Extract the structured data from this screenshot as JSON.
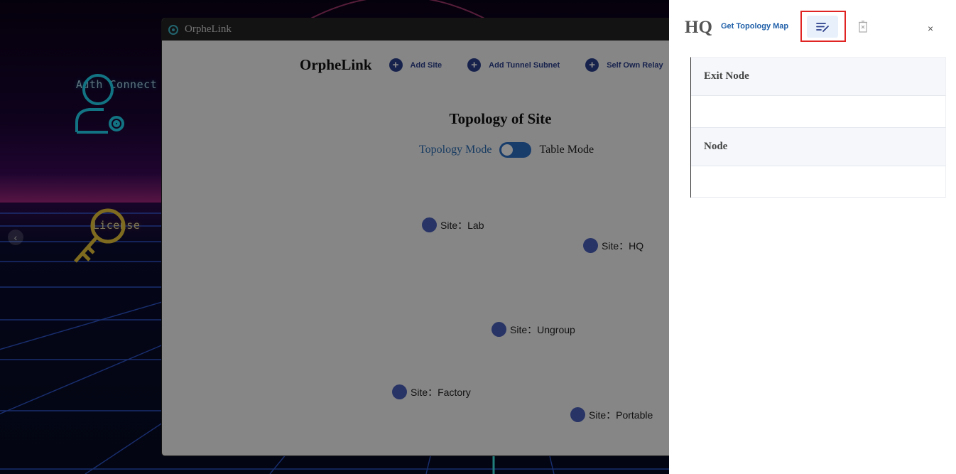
{
  "desktop": {
    "icons": [
      {
        "label": "Auth Connect",
        "icon": "user-gear-icon"
      },
      {
        "label": "License",
        "icon": "key-icon"
      }
    ],
    "carousel_prev": "‹"
  },
  "window": {
    "title": "OrpheLink",
    "toolbar": {
      "brand": "OrpheLink",
      "buttons": [
        "Add Site",
        "Add Tunnel Subnet",
        "Self Own Relay"
      ]
    },
    "topology_title": "Topology of Site",
    "modes": {
      "topology": "Topology Mode",
      "table": "Table Mode",
      "active": "Topology Mode"
    },
    "sites": [
      "Site：Lab",
      "Site：HQ",
      "Site：Ungroup",
      "Site：Factory",
      "Site：Portable"
    ]
  },
  "drawer": {
    "title": "HQ",
    "get_topology_link": "Get Topology Map",
    "close_label": "×",
    "table": [
      {
        "header": "Exit Node",
        "value": ""
      },
      {
        "header": "Node",
        "value": ""
      }
    ]
  },
  "colors": {
    "accent": "#2b3f8a",
    "node": "#4a60b8",
    "link": "#1f5fa8",
    "highlight": "#e02424"
  }
}
